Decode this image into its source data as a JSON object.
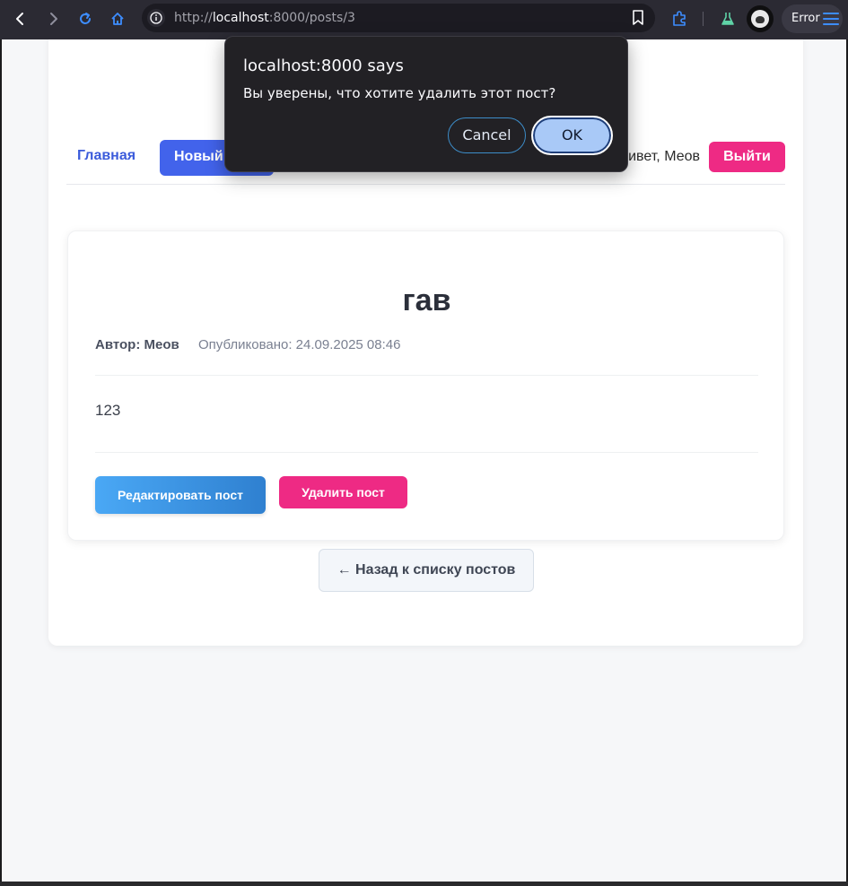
{
  "browser": {
    "url_prefix": "http://",
    "url_host": "localhost",
    "url_rest": ":8000/posts/3",
    "error_label": "Error",
    "accent_color": "#3d8dff"
  },
  "nav": {
    "home": "Главная",
    "new_post": "Новый пост",
    "greeting": "Привет, Меов",
    "logout": "Выйти"
  },
  "post": {
    "title": "гав",
    "author": "Автор: Меов",
    "published": "Опубликовано: 24.09.2025 08:46",
    "body": "123",
    "edit_label": "Редактировать пост",
    "delete_label": "Удалить пост"
  },
  "back_label": "← Назад к списку постов",
  "dialog": {
    "title": "localhost:8000 says",
    "message": "Вы уверены, что хотите удалить этот пост?",
    "cancel": "Cancel",
    "ok": "OK"
  }
}
